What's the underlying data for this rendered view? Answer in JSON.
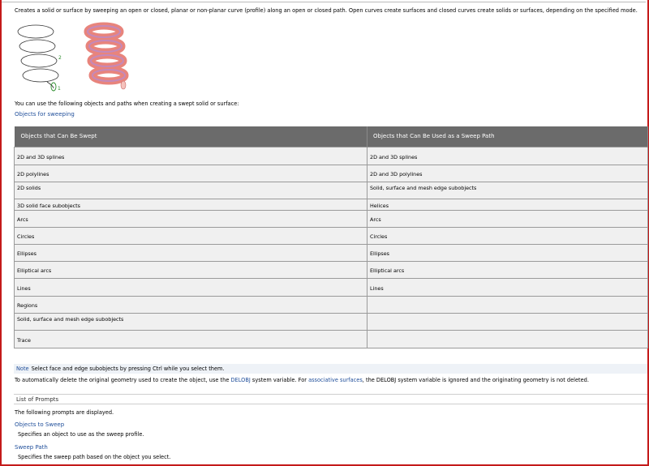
{
  "intro": "Creates a solid or surface by sweeping an open or closed, planar or non-planar curve (profile) along an open or closed path. Open curves create surfaces and closed curves create solids or surfaces, depending on the specified mode.",
  "illustration": {
    "label_profile": "1",
    "label_path": "2",
    "tube_color": "#e8847c",
    "highlight_color": "#b38bd6"
  },
  "use_lead": "You can use the following objects and paths when creating a swept solid or surface:",
  "objects_link": "Objects for sweeping",
  "table": {
    "headers": [
      "Objects that Can Be Swept",
      "Objects that Can Be Used as a Sweep Path"
    ],
    "rows": [
      [
        "2D and 3D splines",
        "2D and 3D splines"
      ],
      [
        "2D polylines",
        "2D and 3D polylines"
      ],
      [
        "2D solids",
        "Solid, surface and mesh edge subobjects"
      ],
      [
        "3D solid face subobjects",
        "Helices"
      ],
      [
        "Arcs",
        "Arcs"
      ],
      [
        "Circles",
        "Circles"
      ],
      [
        "Ellipses",
        "Ellipses"
      ],
      [
        "Elliptical arcs",
        "Elliptical arcs"
      ],
      [
        "Lines",
        "Lines"
      ],
      [
        "Regions",
        ""
      ],
      [
        "Solid, surface and mesh edge subobjects",
        ""
      ],
      [
        "Trace",
        ""
      ]
    ]
  },
  "note": {
    "label": "Note",
    "text": "Select face and edge subobjects by pressing Ctrl while you select them."
  },
  "delobj": {
    "part1": "To automatically delete the original geometry used to create the object, use the ",
    "link1": "DELOBJ",
    "part2": " system variable. For ",
    "link2": "associative surfaces",
    "part3": ", the DELOBJ system variable is ignored and the originating geometry is not deleted."
  },
  "prompts_heading": "List of Prompts",
  "prompts_intro": "The following prompts are displayed.",
  "prompts": [
    {
      "name": "Objects to Sweep",
      "desc": "Specifies an object to use as the sweep profile."
    },
    {
      "name": "Sweep Path",
      "desc": "Specifies the sweep path based on the object you select."
    }
  ]
}
